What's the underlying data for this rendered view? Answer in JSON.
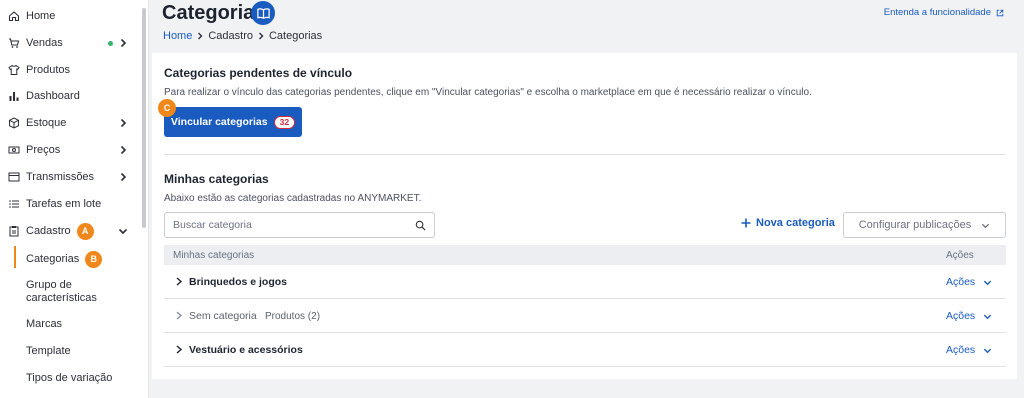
{
  "sidebar": {
    "items": [
      {
        "label": "Home",
        "icon": "home-icon"
      },
      {
        "label": "Vendas",
        "icon": "cart-icon"
      },
      {
        "label": "Produtos",
        "icon": "shirt-icon"
      },
      {
        "label": "Dashboard",
        "icon": "bar-chart-icon"
      },
      {
        "label": "Estoque",
        "icon": "box-icon"
      },
      {
        "label": "Preços",
        "icon": "money-icon"
      },
      {
        "label": "Transmissões",
        "icon": "window-icon"
      },
      {
        "label": "Tarefas em lote",
        "icon": "list-icon"
      },
      {
        "label": "Cadastro",
        "icon": "clipboard-icon"
      }
    ],
    "cadastro_badge": "A",
    "sub_items": [
      "Categorias",
      "Grupo de características",
      "Marcas",
      "Template",
      "Tipos de variação"
    ],
    "categorias_badge": "B",
    "vendas_status_color": "#32b36f",
    "active_color": "#e98a16"
  },
  "header": {
    "title": "Categorias",
    "learn_link": "Entenda a funcionalidade",
    "breadcrumb": [
      "Home",
      "Cadastro",
      "Categorias"
    ]
  },
  "pending": {
    "title": "Categorias pendentes de vínculo",
    "description": "Para realizar o vínculo das categorias pendentes, clique em \"Vincular categorias\" e escolha o marketplace em que é necessário realizar o vínculo.",
    "button_label": "Vincular categorias",
    "button_count": "32",
    "button_badge": "C"
  },
  "my_categories": {
    "title": "Minhas categorias",
    "description": "Abaixo estão as categorias cadastradas no ANYMARKET.",
    "search_placeholder": "Buscar categoria",
    "new_label": "Nova categoria",
    "config_label": "Configurar publicações",
    "columns": [
      "Minhas categorias",
      "Ações"
    ],
    "rows": [
      {
        "name": "Brinquedos e jogos",
        "extra": "",
        "actions": "Ações"
      },
      {
        "name": "Sem categoria",
        "extra": "Produtos (2)",
        "actions": "Ações"
      },
      {
        "name": "Vestuário e acessórios",
        "extra": "",
        "actions": "Ações"
      }
    ]
  },
  "colors": {
    "primary": "#1a5bbf",
    "badge": "#f0871a",
    "danger": "#d4283b"
  }
}
